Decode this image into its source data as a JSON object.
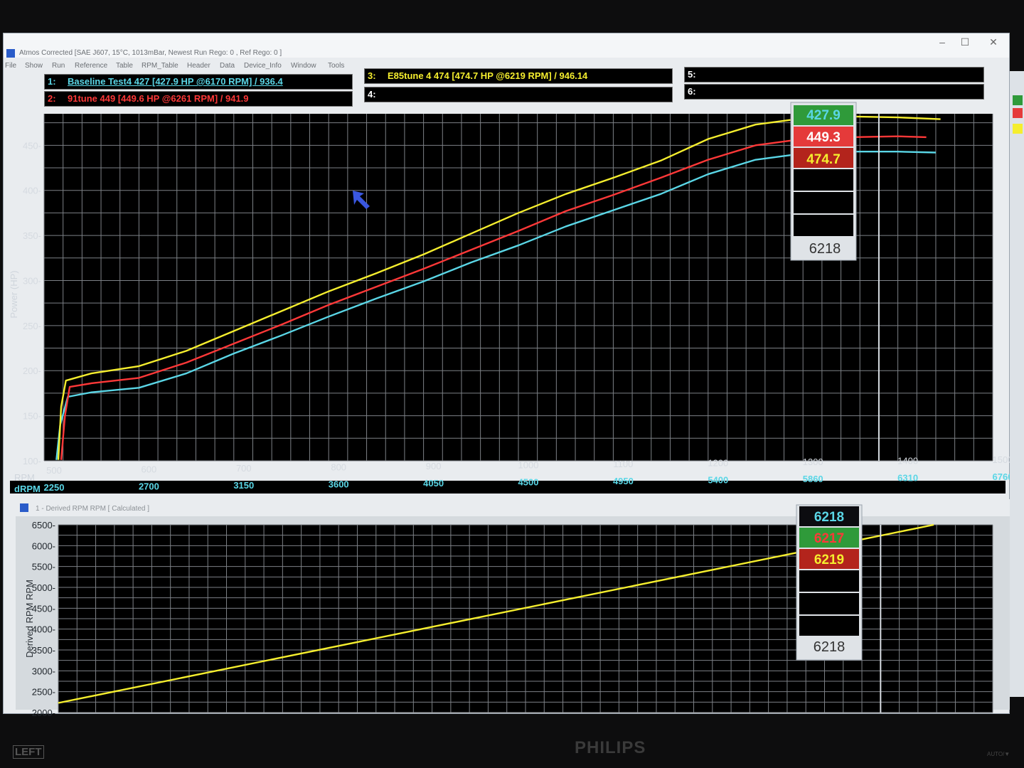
{
  "window": {
    "title": "Atmos Corrected [SAE J607, 15°C, 1013mBar, Newest Run Rego: 0 , Ref Rego: 0 ]",
    "menu": [
      "File",
      "Show",
      "Run",
      "Reference",
      "Table",
      "RPM_Table",
      "Header",
      "Data",
      "Device_Info",
      "Window",
      "Tools"
    ],
    "controls": [
      "–",
      "☐",
      "✕"
    ]
  },
  "legend": [
    {
      "slot": "1:",
      "text": "Baseline Test4 427 [427.9 HP @6170 RPM] / 936.4",
      "color": "#5ad6e6"
    },
    {
      "slot": "2:",
      "text": "91tune 449 [449.6 HP @6261 RPM] / 941.9",
      "color": "#ff3838"
    },
    {
      "slot": "3:",
      "text": "E85tune 4 474 [474.7 HP @6219 RPM] / 946.14",
      "color": "#f5ee2e"
    },
    {
      "slot": "4:",
      "text": "",
      "color": "#ffffff"
    },
    {
      "slot": "5:",
      "text": "",
      "color": "#ffffff"
    },
    {
      "slot": "6:",
      "text": "",
      "color": "#ffffff"
    }
  ],
  "power_readout": {
    "values": [
      "427.9",
      "449.3",
      "474.7"
    ],
    "colors": [
      "#2f9a3a",
      "#e53a3a",
      "#b3241c"
    ],
    "rpm": "6218"
  },
  "rpm_readout": {
    "values": [
      "6218",
      "6217",
      "6219"
    ],
    "colors": [
      "#0c0c10",
      "#2f9a3a",
      "#b3241c"
    ],
    "text_colors": [
      "#5ad6e6",
      "#ff3838",
      "#f5ee2e"
    ],
    "rpm": "6218"
  },
  "lower_window": {
    "title": "1 - Derived RPM RPM     [ Calculated ]"
  },
  "monitor": {
    "left_label": "LEFT",
    "brand": "PHILIPS",
    "auto_label": "AUTO/▼"
  },
  "chart_data": [
    {
      "type": "line",
      "title": "",
      "ylabel": "Power (HP)",
      "xlabel": "RPM",
      "xlabel2": "dRPM",
      "x_ticks": [
        "500",
        "600",
        "700",
        "800",
        "900",
        "1000",
        "1100",
        "1200",
        "1300",
        "1400",
        "1500"
      ],
      "x2_ticks": [
        "2250",
        "2700",
        "3150",
        "3600",
        "4050",
        "4500",
        "4950",
        "5400",
        "5860",
        "6310",
        "6760"
      ],
      "xlim": [
        500,
        1500
      ],
      "y_ticks": [
        100,
        150,
        200,
        250,
        300,
        350,
        400,
        450
      ],
      "ylim": [
        100,
        485
      ],
      "grid": true,
      "cursor_x": 1380,
      "series": [
        {
          "name": "Baseline Test4 427",
          "color": "#5ad6e6",
          "x": [
            513,
            517,
            525,
            550,
            600,
            650,
            700,
            750,
            800,
            850,
            900,
            950,
            1000,
            1050,
            1100,
            1150,
            1200,
            1250,
            1300,
            1350,
            1400,
            1440
          ],
          "y": [
            101,
            140,
            171,
            176,
            181,
            197,
            219,
            239,
            260,
            280,
            299,
            320,
            339,
            360,
            378,
            396,
            418,
            434,
            441,
            443,
            443,
            442
          ]
        },
        {
          "name": "91tune 449",
          "color": "#ff3838",
          "x": [
            518,
            522,
            527,
            550,
            600,
            650,
            700,
            750,
            800,
            850,
            900,
            950,
            1000,
            1050,
            1100,
            1150,
            1200,
            1250,
            1300,
            1350,
            1400,
            1430
          ],
          "y": [
            101,
            150,
            182,
            186,
            192,
            209,
            230,
            251,
            273,
            293,
            313,
            334,
            355,
            377,
            395,
            414,
            434,
            450,
            457,
            459,
            460,
            459
          ]
        },
        {
          "name": "E85tune 4 474",
          "color": "#f5ee2e",
          "x": [
            515,
            518,
            523,
            550,
            600,
            650,
            700,
            750,
            800,
            850,
            900,
            950,
            1000,
            1050,
            1100,
            1150,
            1200,
            1250,
            1300,
            1350,
            1400,
            1445
          ],
          "y": [
            101,
            160,
            189,
            197,
            205,
            222,
            244,
            266,
            288,
            308,
            329,
            352,
            375,
            396,
            414,
            433,
            457,
            473,
            480,
            482,
            481,
            479
          ]
        }
      ]
    },
    {
      "type": "line",
      "title": "",
      "ylabel": "Derived RPM RPM",
      "y_ticks": [
        2000,
        2500,
        3000,
        3500,
        4000,
        4500,
        5000,
        5500,
        6000,
        6500
      ],
      "ylim": [
        2000,
        6500
      ],
      "xlim": [
        500,
        1500
      ],
      "grid": true,
      "cursor_x": 1380,
      "series": [
        {
          "name": "Derived RPM",
          "color": "#f5ee2e",
          "x": [
            500,
            1450
          ],
          "y": [
            2230,
            6560
          ]
        }
      ]
    }
  ]
}
